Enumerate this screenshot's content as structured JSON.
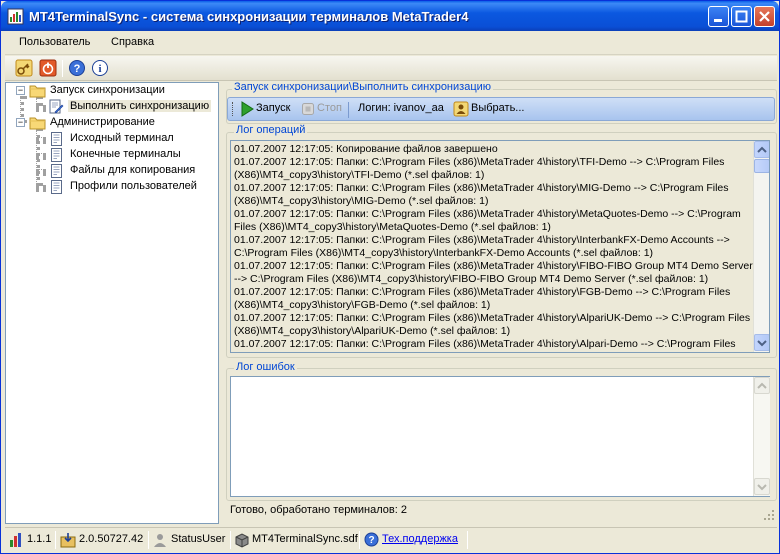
{
  "window": {
    "title": "MT4TerminalSync - система синхронизации терминалов MetaTrader4"
  },
  "menu": [
    "Пользователь",
    "Справка"
  ],
  "tree": {
    "items": [
      {
        "label": "Запуск синхронизации",
        "level": 0,
        "expanded": true
      },
      {
        "label": "Выполнить синхронизацию",
        "level": 1,
        "selected": true
      },
      {
        "label": "Администрирование",
        "level": 0,
        "expanded": true
      },
      {
        "label": "Исходный терминал",
        "level": 1
      },
      {
        "label": "Конечные терминалы",
        "level": 1
      },
      {
        "label": "Файлы для копирования",
        "level": 1
      },
      {
        "label": "Профили пользователей",
        "level": 1
      }
    ]
  },
  "main": {
    "breadcrumb": "Запуск синхронизации\\Выполнить синхронизацию",
    "toolbar": {
      "start_label": "Запуск",
      "stop_label": "Стоп",
      "login_label": "Логин: ivanov_aa",
      "choose_label": "Выбрать..."
    },
    "ops_log_title": "Лог операций",
    "ops_log": [
      "01.07.2007 12:17:05: Копирование файлов завершено",
      "01.07.2007 12:17:05: Папки: C:\\Program Files (x86)\\MetaTrader 4\\history\\TFI-Demo --> C:\\Program Files (X86)\\MT4_copy3\\history\\TFI-Demo (*.sel файлов: 1)",
      "01.07.2007 12:17:05: Папки: C:\\Program Files (x86)\\MetaTrader 4\\history\\MIG-Demo --> C:\\Program Files (X86)\\MT4_copy3\\history\\MIG-Demo (*.sel файлов: 1)",
      "01.07.2007 12:17:05: Папки: C:\\Program Files (x86)\\MetaTrader 4\\history\\MetaQuotes-Demo --> C:\\Program Files (X86)\\MT4_copy3\\history\\MetaQuotes-Demo (*.sel файлов: 1)",
      "01.07.2007 12:17:05: Папки: C:\\Program Files (x86)\\MetaTrader 4\\history\\InterbankFX-Demo Accounts --> C:\\Program Files (X86)\\MT4_copy3\\history\\InterbankFX-Demo Accounts (*.sel файлов: 1)",
      "01.07.2007 12:17:05: Папки: C:\\Program Files (x86)\\MetaTrader 4\\history\\FIBO-FIBO Group MT4 Demo Server --> C:\\Program Files (X86)\\MT4_copy3\\history\\FIBO-FIBO Group MT4 Demo Server (*.sel файлов: 1)",
      "01.07.2007 12:17:05: Папки: C:\\Program Files (x86)\\MetaTrader 4\\history\\FGB-Demo --> C:\\Program Files (X86)\\MT4_copy3\\history\\FGB-Demo (*.sel файлов: 1)",
      "01.07.2007 12:17:05: Папки: C:\\Program Files (x86)\\MetaTrader 4\\history\\AlpariUK-Demo --> C:\\Program Files (X86)\\MT4_copy3\\history\\AlpariUK-Demo (*.sel файлов: 1)",
      "01.07.2007 12:17:05: Папки: C:\\Program Files (x86)\\MetaTrader 4\\history\\Alpari-Demo --> C:\\Program Files"
    ],
    "err_log_title": "Лог ошибок",
    "status_text": "Готово, обработано терминалов: 2"
  },
  "statusbar": {
    "version": "1.1.1",
    "framework": "2.0.50727.42",
    "user": "StatusUser",
    "db_file": "MT4TerminalSync.sdf",
    "support_link": "Тех.поддержка"
  },
  "colors": {
    "title_blue": "#0a4fd6",
    "group_label": "#0046d5",
    "panel_bg": "#ece9d8"
  },
  "icons": [
    "app-icon",
    "key-icon",
    "power-icon",
    "help-icon",
    "info-icon",
    "folder-icon",
    "document-icon",
    "play-icon",
    "stop-icon",
    "chart-icon",
    "install-icon",
    "user-icon",
    "database-icon",
    "help-link-icon"
  ]
}
